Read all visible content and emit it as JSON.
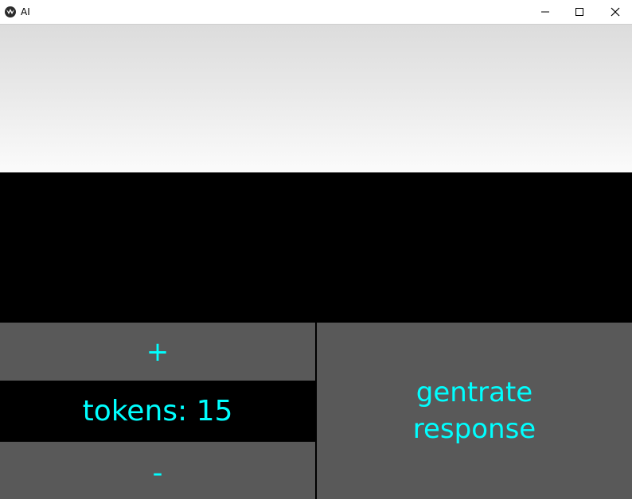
{
  "window": {
    "title": "AI",
    "controls": {
      "minimize_icon": "minimize-icon",
      "maximize_icon": "maximize-icon",
      "close_icon": "close-icon"
    }
  },
  "prompt_input": {
    "value": "",
    "placeholder": ""
  },
  "output": {
    "text": ""
  },
  "controls": {
    "increase_label": "+",
    "tokens_label": "tokens: 15",
    "decrease_label": "-",
    "generate_label": "gentrate\nresponse"
  },
  "colors": {
    "button_bg": "#595959",
    "text_accent": "#00ffff",
    "background": "#000000"
  }
}
